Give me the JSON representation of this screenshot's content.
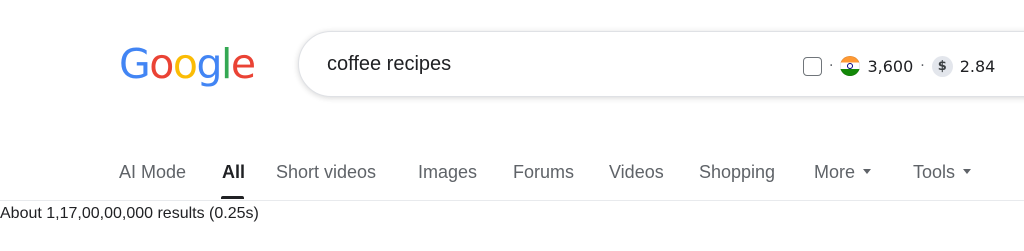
{
  "logo": {
    "letters": [
      "G",
      "o",
      "o",
      "g",
      "l",
      "e"
    ],
    "colors": [
      "#4285F4",
      "#EA4335",
      "#FBBC05",
      "#4285F4",
      "#34A853",
      "#EA4335"
    ]
  },
  "search": {
    "query": "coffee recipes",
    "extension": {
      "flag_icon": "india-flag-icon",
      "volume": "3,600",
      "currency_icon": "dollar-icon",
      "cpc": "2.84"
    }
  },
  "tabs": [
    {
      "label": "AI Mode"
    },
    {
      "label": "All",
      "active": true
    },
    {
      "label": "Short videos"
    },
    {
      "label": "Images"
    },
    {
      "label": "Forums"
    },
    {
      "label": "Videos"
    },
    {
      "label": "Shopping"
    },
    {
      "label": "More"
    },
    {
      "label": "Tools"
    }
  ],
  "result_stats": "About 1,17,00,00,000 results (0.25s)"
}
